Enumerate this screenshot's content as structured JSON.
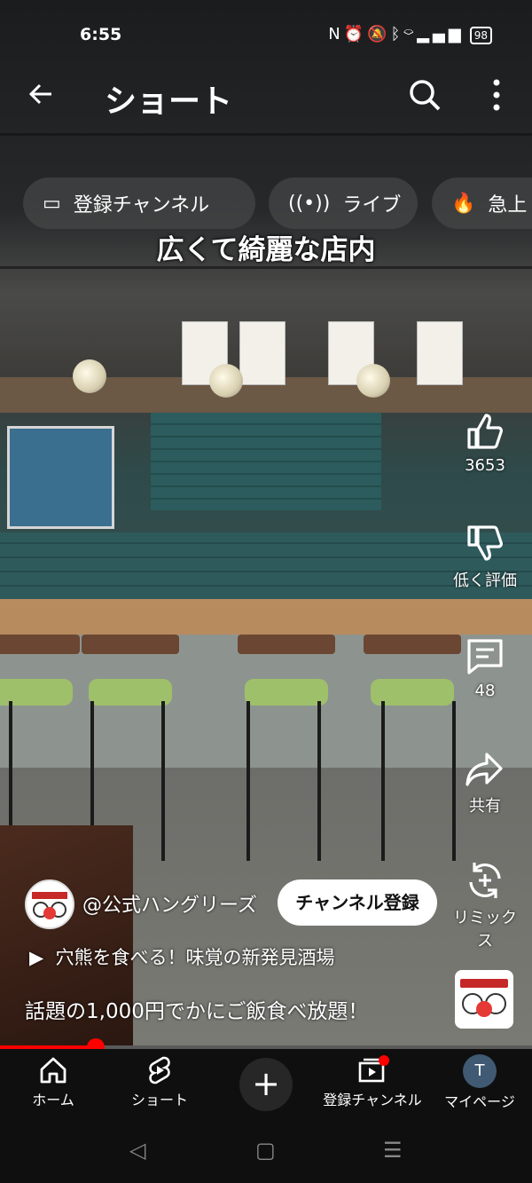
{
  "status_bar": {
    "time": "6:55",
    "icons": [
      "nfc-icon",
      "alarm-icon",
      "mute-icon",
      "bluetooth-icon",
      "wifi-icon",
      "volte-icon",
      "signal-icon"
    ],
    "battery": "98"
  },
  "header": {
    "title": "ショート"
  },
  "chips": [
    {
      "label": "登録チャンネル",
      "icon": "subscriptions-icon"
    },
    {
      "label": "ライブ",
      "icon": "live-icon"
    },
    {
      "label": "急上",
      "icon": "trending-icon"
    }
  ],
  "video": {
    "overlay_caption": "広くて綺麗な店内"
  },
  "actions": {
    "like_count": "3653",
    "dislike_label": "低く評価",
    "comment_count": "48",
    "share_label": "共有",
    "remix_label": "リミックス"
  },
  "channel": {
    "name": "@公式ハングリーズ",
    "subscribe_label": "チャンネル登録",
    "playlist_title": "穴熊を食べる！味覚の新発見酒場",
    "video_title": "話題の1,000円でかにご飯食べ放題！"
  },
  "progress": {
    "played_fraction": 0.18
  },
  "bottom_nav": {
    "home": "ホーム",
    "shorts": "ショート",
    "subscriptions": "登録チャンネル",
    "you": "マイページ",
    "avatar_initial": "T"
  },
  "colors": {
    "accent": "#ff0000",
    "nav_bg": "#0f0f0f"
  }
}
